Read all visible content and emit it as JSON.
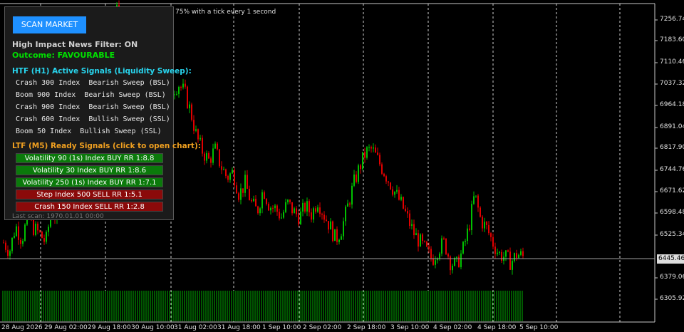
{
  "panel": {
    "scan_button": "SCAN MARKET",
    "news_filter": "High Impact News Filter: ON",
    "outcome": "Outcome: FAVOURABLE",
    "htf_title": "HTF (H1) Active Signals (Liquidity Sweep):",
    "htf_signals": [
      "Crash 300 Index  Bearish Sweep (BSL)",
      "Boom 900 Index  Bearish Sweep (BSL)",
      "Crash 900 Index  Bearish Sweep (BSL)",
      "Crash 600 Index  Bullish Sweep (SSL)",
      "Boom 50 Index  Bullish Sweep (SSL)"
    ],
    "ltf_title": "LTF (M5) Ready Signals (click to open chart):",
    "ltf_signals": [
      {
        "label": "Volatility 90 (1s) Index BUY  RR 1:8.8",
        "side": "buy"
      },
      {
        "label": "Volatility 30 Index BUY  RR 1:8.6",
        "side": "buy"
      },
      {
        "label": "Volatility 250 (1s) Index BUY  RR 1:7.1",
        "side": "buy"
      },
      {
        "label": "Step Index 500 SELL  RR 1:5.1",
        "side": "sell"
      },
      {
        "label": "Crash 150 Index SELL  RR 1:2.8",
        "side": "sell"
      }
    ],
    "last_scan": "Last scan: 1970.01.01 00:00"
  },
  "chart": {
    "notice": "75% with a tick every 1 second",
    "price_labels": [
      "7256.74",
      "7183.60",
      "7110.46",
      "7037.32",
      "6964.18",
      "6891.04",
      "6817.90",
      "6744.76",
      "6671.62",
      "6598.48",
      "6525.34",
      "6379.06",
      "6305.92"
    ],
    "current_price": "6445.46",
    "date_labels": [
      "28 Aug 2026",
      "29 Aug 02:00",
      "29 Aug 18:00",
      "30 Aug 10:00",
      "31 Aug 02:00",
      "31 Aug 18:00",
      "1 Sep 10:00",
      "2 Sep 02:00",
      "2 Sep 18:00",
      "3 Sep 10:00",
      "4 Sep 02:00",
      "4 Sep 18:00",
      "5 Sep 10:00"
    ],
    "colors": {
      "bull": "#00c000",
      "bear": "#e00000",
      "grid": "#c8c8c8",
      "volume": "#00b000"
    },
    "price_path": [
      6470,
      6440,
      6530,
      6480,
      6560,
      6520,
      6500,
      6470,
      6600,
      6530,
      6640,
      6700,
      6780,
      6860,
      6920,
      6990,
      7060,
      7150,
      7240,
      7300,
      7230,
      7090,
      7030,
      6980,
      6960,
      6900,
      6880,
      6960,
      7010,
      7030,
      7000,
      6930,
      6840,
      6790,
      6760,
      6800,
      6740,
      6700,
      6720,
      6640,
      6680,
      6610,
      6580,
      6660,
      6600,
      6590,
      6560,
      6610,
      6580,
      6560,
      6600,
      6570,
      6620,
      6570,
      6530,
      6480,
      6520,
      6600,
      6680,
      6740,
      6790,
      6800,
      6760,
      6720,
      6680,
      6640,
      6600,
      6550,
      6500,
      6470,
      6440,
      6410,
      6450,
      6470,
      6400,
      6390,
      6440,
      6520,
      6640,
      6550,
      6520,
      6470,
      6430,
      6420,
      6400,
      6430,
      6420
    ]
  }
}
